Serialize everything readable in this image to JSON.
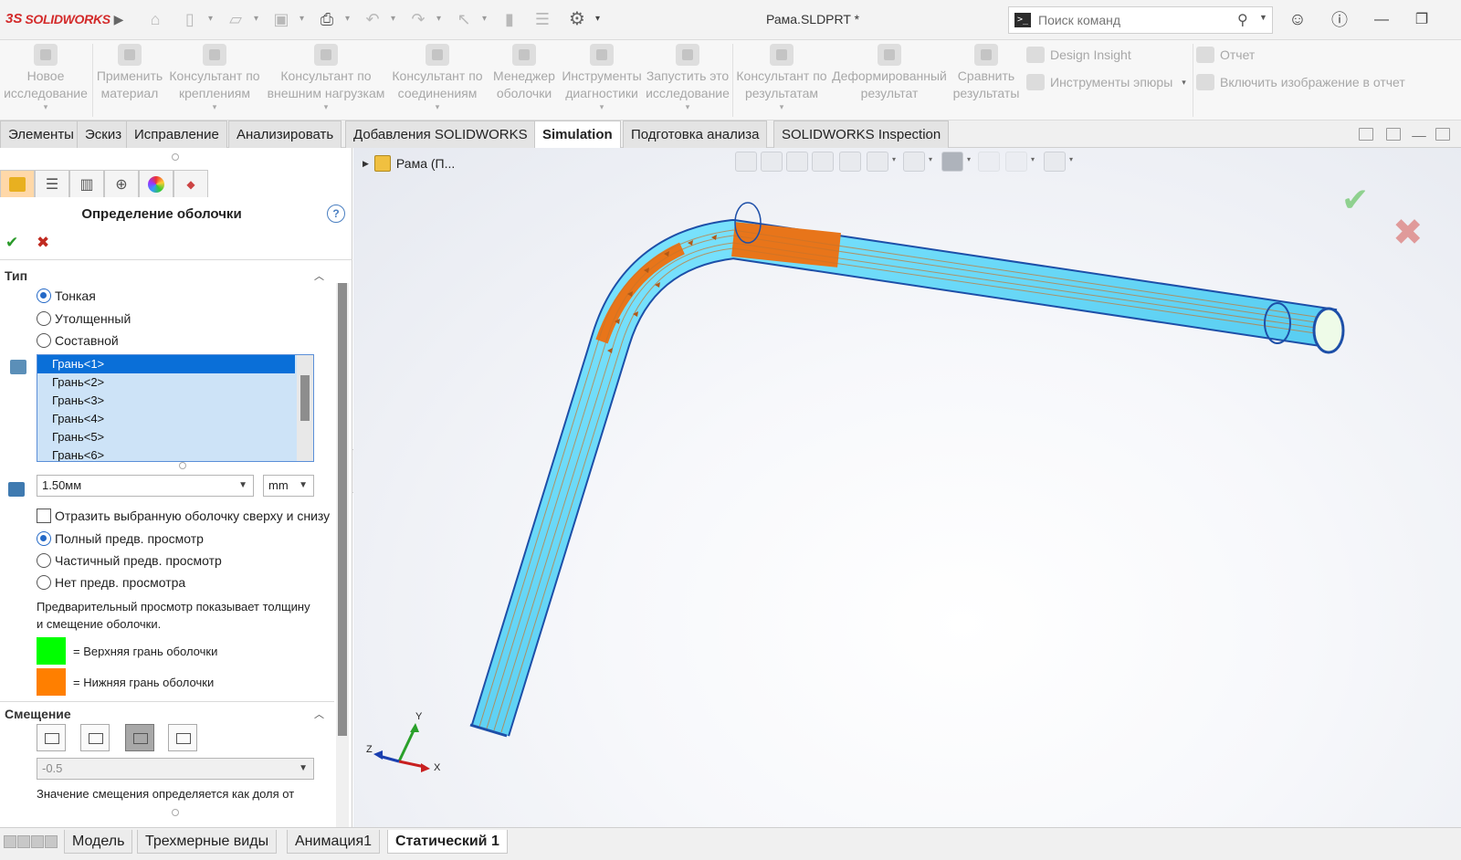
{
  "app": {
    "logo_ds": "3S",
    "logo_text": "SOLIDWORKS",
    "document_title": "Рама.SLDPRT *",
    "command_search_placeholder": "Поиск команд"
  },
  "ribbon": {
    "groups": [
      {
        "label": "Новое\nисследование",
        "icon": "new-study-icon",
        "dropdown": true
      },
      {
        "label": "Применить\nматериал",
        "icon": "material-icon",
        "dropdown": false
      },
      {
        "label": "Консультант по\nкреплениям",
        "icon": "fixtures-icon",
        "dropdown": true
      },
      {
        "label": "Консультант по\nвнешним нагрузкам",
        "icon": "loads-icon",
        "dropdown": true
      },
      {
        "label": "Консультант по\nсоединениям",
        "icon": "connections-icon",
        "dropdown": true
      },
      {
        "label": "Менеджер\nоболочки",
        "icon": "shell-manager-icon",
        "dropdown": false
      },
      {
        "label": "Инструменты\nдиагностики",
        "icon": "diagnostics-icon",
        "dropdown": true
      },
      {
        "label": "Запустить это\nисследование",
        "icon": "run-icon",
        "dropdown": true
      },
      {
        "label": "Консультант по\nрезультатам",
        "icon": "results-icon",
        "dropdown": true
      },
      {
        "label": "Деформированный\nрезультат",
        "icon": "deformed-icon",
        "dropdown": false
      },
      {
        "label": "Сравнить\nрезультаты",
        "icon": "compare-icon",
        "dropdown": false
      }
    ],
    "small": {
      "design_insight": "Design Insight",
      "plot_tools": "Инструменты эпюры",
      "report": "Отчет",
      "include_image": "Включить изображение в отчет"
    }
  },
  "tabs": [
    {
      "label": "Элементы",
      "active": false
    },
    {
      "label": "Эскиз",
      "active": false
    },
    {
      "label": "Исправление",
      "active": false
    },
    {
      "label": "Анализировать",
      "active": false
    },
    {
      "label": "Добавления SOLIDWORKS",
      "active": false
    },
    {
      "label": "Simulation",
      "active": true
    },
    {
      "label": "Подготовка анализа",
      "active": false
    },
    {
      "label": "SOLIDWORKS Inspection",
      "active": false
    }
  ],
  "property_manager": {
    "title": "Определение оболочки",
    "help": "?",
    "type_section": {
      "title": "Тип",
      "options": [
        {
          "label": "Тонкая",
          "selected": true
        },
        {
          "label": "Утолщенный",
          "selected": false
        },
        {
          "label": "Составной",
          "selected": false
        }
      ]
    },
    "faces": [
      {
        "label": "Грань<1>",
        "selected": true
      },
      {
        "label": "Грань<2>",
        "selected": false
      },
      {
        "label": "Грань<3>",
        "selected": false
      },
      {
        "label": "Грань<4>",
        "selected": false
      },
      {
        "label": "Грань<5>",
        "selected": false
      },
      {
        "label": "Грань<6>",
        "selected": false
      }
    ],
    "thickness_value": "1.50мм",
    "unit_value": "mm",
    "flip_label": "Отразить выбранную оболочку сверху и снизу",
    "flip_checked": false,
    "preview_options": [
      {
        "label": "Полный предв. просмотр",
        "selected": true
      },
      {
        "label": "Частичный предв. просмотр",
        "selected": false
      },
      {
        "label": "Нет предв. просмотра",
        "selected": false
      }
    ],
    "preview_note": "Предварительный просмотр показывает толщину и смещение оболочки.",
    "legend": [
      {
        "color": "#00ff00",
        "label": "= Верхняя грань оболочки"
      },
      {
        "color": "#ff7f00",
        "label": "= Нижняя грань оболочки"
      }
    ],
    "offset_section": {
      "title": "Смещение",
      "value": "-0.5",
      "note": "Значение смещения определяется как доля от"
    }
  },
  "viewport": {
    "tree_root_label": "Рама (П...",
    "triad": {
      "x": "X",
      "y": "Y",
      "z": "Z"
    },
    "colors": {
      "shell": "#5fd7f7",
      "bottom_face": "#e8751a",
      "accept": "#8fd18f",
      "reject": "#e09a9a"
    }
  },
  "bottom_tabs": [
    {
      "label": "Модель",
      "active": false
    },
    {
      "label": "Трехмерные виды",
      "active": false
    },
    {
      "label": "Анимация1",
      "active": false
    },
    {
      "label": "Статический 1",
      "active": true
    }
  ]
}
